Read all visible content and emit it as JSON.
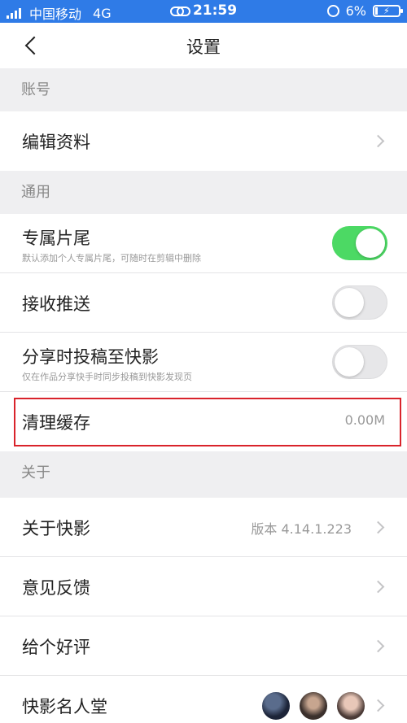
{
  "status_bar": {
    "carrier": "中国移动",
    "network": "4G",
    "time": "21:59",
    "battery": "6%",
    "icons": [
      "signal-icon",
      "link-icon",
      "alarm-icon",
      "battery-icon"
    ]
  },
  "nav": {
    "title": "设置",
    "back_icon": "chevron-left-icon"
  },
  "sections": {
    "account": {
      "header": "账号",
      "items": [
        {
          "label": "编辑资料",
          "icon": "chevron-right-icon"
        }
      ]
    },
    "general": {
      "header": "通用",
      "items": [
        {
          "label": "专属片尾",
          "sublabel": "默认添加个人专属片尾，可随时在剪辑中删除",
          "toggle": "on"
        },
        {
          "label": "接收推送",
          "toggle": "off"
        },
        {
          "label": "分享时投稿至快影",
          "sublabel": "仅在作品分享快手时同步投稿到快影发现页",
          "toggle": "off"
        },
        {
          "label": "清理缓存",
          "value": "0.00M"
        }
      ]
    },
    "about": {
      "header": "关于",
      "items": [
        {
          "label": "关于快影",
          "value": "版本 4.14.1.223",
          "icon": "chevron-right-icon"
        },
        {
          "label": "意见反馈",
          "icon": "chevron-right-icon"
        },
        {
          "label": "给个好评",
          "icon": "chevron-right-icon"
        },
        {
          "label": "快影名人堂",
          "icon": "avatar-stack"
        }
      ]
    }
  },
  "colors": {
    "status_bar": "#2f7be7",
    "toggle_on": "#4cd964",
    "highlight": "#d9232b",
    "background": "#efeff1"
  }
}
